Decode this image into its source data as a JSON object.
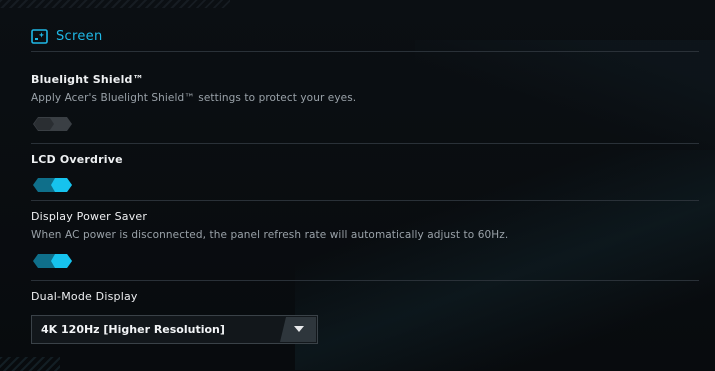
{
  "header": {
    "title": "Screen",
    "icon": "screen-sparkle-icon",
    "accent_color": "#1fb8e6"
  },
  "settings": [
    {
      "title": "Bluelight Shield™",
      "description": "Apply Acer's Bluelight Shield™ settings to protect your eyes.",
      "toggle_state": "off"
    },
    {
      "title": "LCD Overdrive",
      "toggle_state": "on"
    },
    {
      "title": "Display Power Saver",
      "description": "When AC power is disconnected, the panel refresh rate will automatically adjust to 60Hz.",
      "toggle_state": "on"
    },
    {
      "title": "Dual-Mode Display",
      "dropdown": {
        "selected": "4K 120Hz [Higher Resolution]",
        "icon": "caret-down-icon"
      }
    }
  ],
  "colors": {
    "toggle_on": "#16b5e0",
    "toggle_off": "#3a3f44",
    "background": "#0a0d10"
  }
}
